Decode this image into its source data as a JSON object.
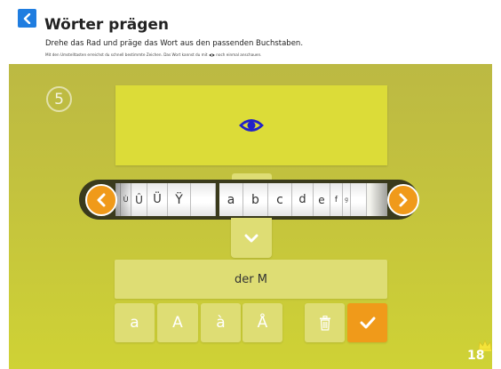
{
  "header": {
    "title": "Wörter prägen",
    "subtitle": "Drehe das Rad und präge das Wort aus den passenden Buchstaben.",
    "hint_before": "Mit den Umstelltasten erreichst du schnell bestimmte Zeichen. Das Wort kannst du mit",
    "hint_after": "noch einmal anschauen."
  },
  "level": "5",
  "wheel": {
    "letters": [
      "Ù",
      "Û",
      "Ü",
      "Ÿ",
      "",
      "a",
      "b",
      "c",
      "d",
      "e",
      "f",
      "g"
    ]
  },
  "answer": "der M",
  "keys": [
    "a",
    "A",
    "à",
    "Å"
  ],
  "score": "18",
  "colors": {
    "accent_orange": "#f09a1a",
    "back_blue": "#1f7de0",
    "eye_blue": "#2222c8",
    "stage_yellow": "#c3c23e"
  }
}
